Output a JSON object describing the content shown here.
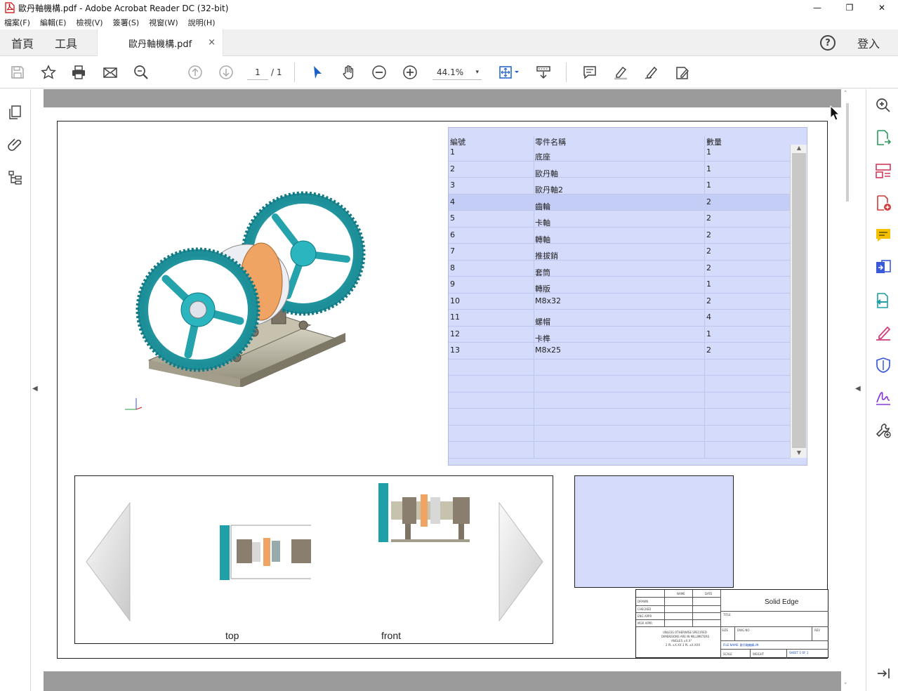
{
  "window": {
    "title": "歐丹軸機構.pdf - Adobe Acrobat Reader DC (32-bit)",
    "minimize": "—",
    "maximize": "❐",
    "close": "✕"
  },
  "menu": [
    "檔案(F)",
    "編輯(E)",
    "檢視(V)",
    "簽署(S)",
    "視窗(W)",
    "說明(H)"
  ],
  "tabs": {
    "home": "首頁",
    "tools": "工具",
    "document": "歐丹軸機構.pdf",
    "close": "×",
    "help": "?",
    "login": "登入"
  },
  "toolbar": {
    "page_current": "1",
    "page_total": "/ 1",
    "zoom": "44.1%",
    "zoom_arrow": "▾"
  },
  "icons": {
    "left_nav": [
      "pages-icon",
      "attachment-icon",
      "layers-icon"
    ],
    "right_nav": [
      "search-zoom-icon",
      "export-pdf-icon",
      "organize-pages-icon",
      "create-pdf-icon",
      "comment-icon",
      "combine-files-icon",
      "send-for-review-icon",
      "fill-sign-icon",
      "protect-icon",
      "sign-icon",
      "more-tools-icon",
      "expand-panel-icon"
    ]
  },
  "parts_table": {
    "headers": [
      "編號",
      "零件名稱",
      "數量"
    ],
    "rows": [
      {
        "no": "1",
        "name": "底座",
        "qty": "1"
      },
      {
        "no": "2",
        "name": "歐丹軸",
        "qty": "1"
      },
      {
        "no": "3",
        "name": "歐丹軸2",
        "qty": "1"
      },
      {
        "no": "4",
        "name": "齒輪",
        "qty": "2"
      },
      {
        "no": "5",
        "name": "卡軸",
        "qty": "2"
      },
      {
        "no": "6",
        "name": "轉軸",
        "qty": "2"
      },
      {
        "no": "7",
        "name": "推拔銷",
        "qty": "2"
      },
      {
        "no": "8",
        "name": "套筒",
        "qty": "2"
      },
      {
        "no": "9",
        "name": "轉版",
        "qty": "1"
      },
      {
        "no": "10",
        "name": "M8x32",
        "qty": "2"
      },
      {
        "no": "11",
        "name": "螺帽",
        "qty": "4"
      },
      {
        "no": "12",
        "name": "卡榫",
        "qty": "1"
      },
      {
        "no": "13",
        "name": "M8x25",
        "qty": "2"
      },
      {
        "no": "",
        "name": "",
        "qty": ""
      },
      {
        "no": "",
        "name": "",
        "qty": ""
      },
      {
        "no": "",
        "name": "",
        "qty": ""
      },
      {
        "no": "",
        "name": "",
        "qty": ""
      },
      {
        "no": "",
        "name": "",
        "qty": ""
      },
      {
        "no": "",
        "name": "",
        "qty": ""
      }
    ],
    "selected_row": 3
  },
  "views": {
    "top_label": "top",
    "front_label": "front"
  },
  "title_block": {
    "brand": "Solid Edge",
    "name_col": "NAME",
    "date_col": "DATE",
    "drawn": "DRAWN",
    "checked": "CHECKED",
    "eng_appr": "ENG APPR",
    "mgr_appr": "MGR APPR",
    "unless": "UNLESS OTHERWISE SPECIFIED",
    "dims": "DIMENSIONS ARE IN MILLIMETERS",
    "angles": "ANGLES ±X.X°",
    "places": "2 PL ±X.XX 3 PL ±X.XXX",
    "title": "TITLE",
    "size": "SIZE",
    "dwg_no": "DWG NO",
    "rev": "REV",
    "file_name": "FILE NAME: 歐丹軸機構.dft",
    "scale": "SCALE",
    "weight": "WEIGHT",
    "sheet": "SHEET 1 OF 1"
  }
}
